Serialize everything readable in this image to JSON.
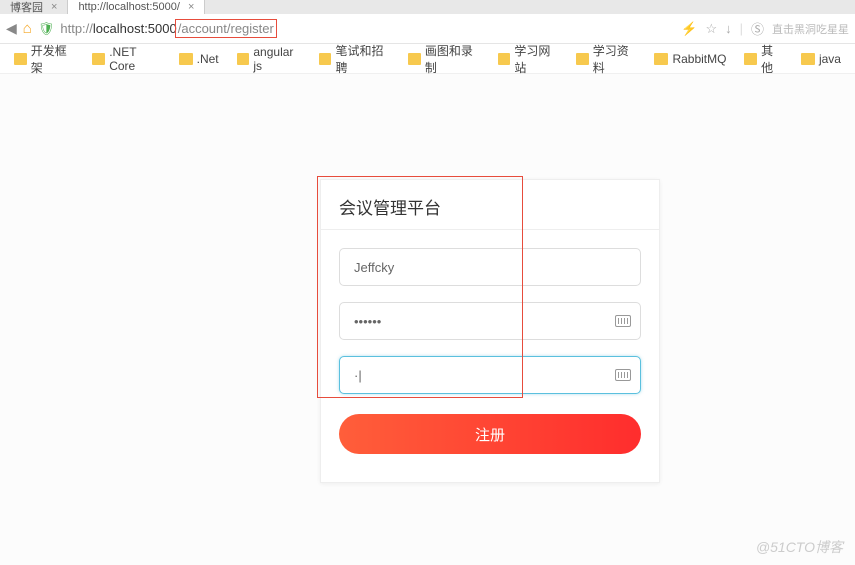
{
  "tabs": [
    {
      "title": "博客园"
    },
    {
      "title": "http://localhost:5000/"
    }
  ],
  "address": {
    "prefix": "http://",
    "host": "localhost:5000",
    "path_highlighted": "/account/register",
    "right_text": "直击黑洞吃星星",
    "star": "☆",
    "download": "↓"
  },
  "bookmarks": [
    "开发框架",
    ".NET Core",
    ".Net",
    "angular js",
    "笔试和招聘",
    "画图和录制",
    "学习网站",
    "学习资料",
    "RabbitMQ",
    "其他",
    "java"
  ],
  "form": {
    "title": "会议管理平台",
    "username_value": "Jeffcky",
    "password_value": "••••••",
    "confirm_value": "·|",
    "submit_label": "注册"
  },
  "watermark": "@51CTO博客"
}
